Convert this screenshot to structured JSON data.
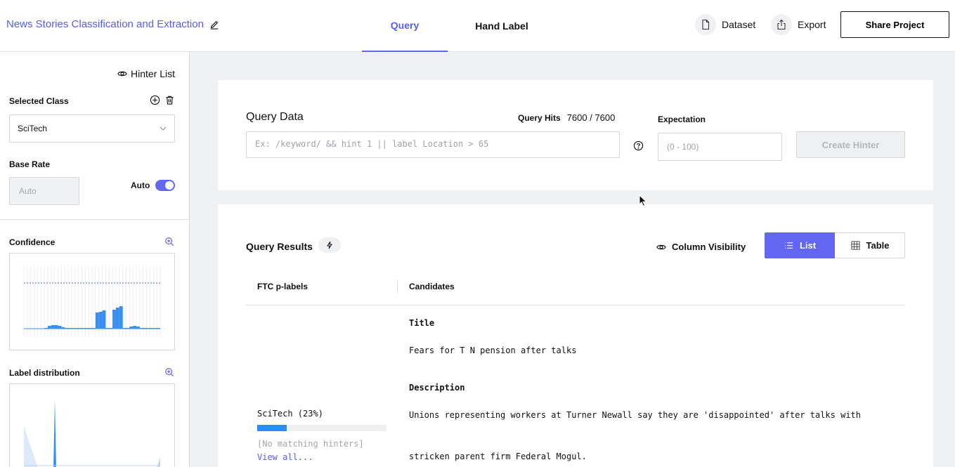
{
  "header": {
    "project_title": "News Stories Classification and Extraction",
    "tabs": [
      {
        "label": "Query",
        "active": true
      },
      {
        "label": "Hand Label",
        "active": false
      }
    ],
    "dataset_label": "Dataset",
    "export_label": "Export",
    "share_label": "Share Project",
    "accent_color": "#6366f1"
  },
  "sidebar": {
    "hinter_list_label": "Hinter List",
    "selected_class_label": "Selected Class",
    "selected_class_value": "SciTech",
    "base_rate_label": "Base Rate",
    "base_rate_placeholder": "Auto",
    "auto_label": "Auto",
    "auto_enabled": true,
    "confidence_label": "Confidence",
    "label_distribution_label": "Label distribution"
  },
  "query": {
    "title": "Query Data",
    "hits_label": "Query Hits",
    "hits_value": "7600 / 7600",
    "placeholder": "Ex: /keyword/ && hint 1 || label Location > 65",
    "expectation_label": "Expectation",
    "expectation_placeholder": "(0 - 100)",
    "create_hinter_label": "Create Hinter"
  },
  "results": {
    "title": "Query Results",
    "column_visibility_label": "Column Visibility",
    "view_list_label": "List",
    "view_table_label": "Table",
    "columns": [
      "FTC p-labels",
      "Candidates"
    ],
    "row": {
      "title_label": "Title",
      "title_value": "Fears for T N pension after talks",
      "description_label": "Description",
      "description_line1": "Unions representing workers at Turner Newall say they are 'disappointed' after talks with",
      "description_line2": "stricken parent firm Federal Mogul.",
      "plabel": "SciTech (23%)",
      "plabel_fraction": 0.23,
      "no_hinters": "[No matching hinters]",
      "view_all": "View all..."
    }
  }
}
